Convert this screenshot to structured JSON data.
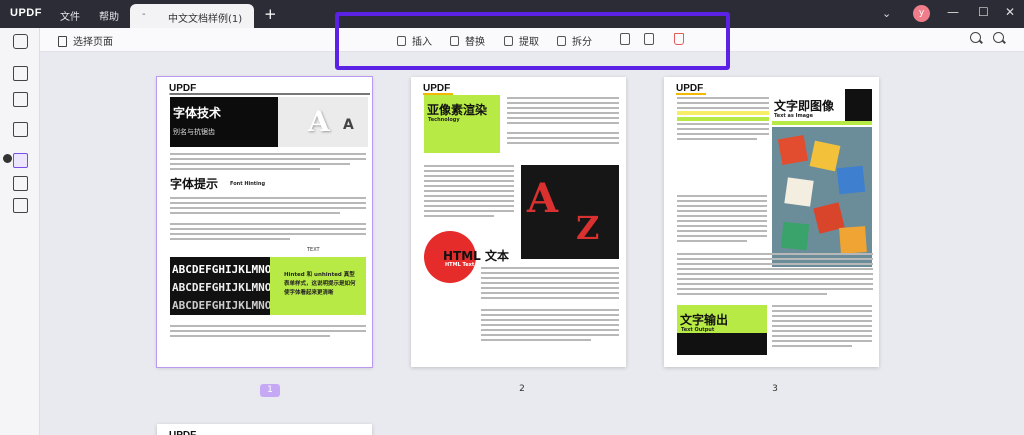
{
  "app": {
    "logo": "UPDF",
    "menu": [
      "文件",
      "帮助"
    ],
    "tab_title": "中文文档样例(1)",
    "tab_close": "-",
    "tab_add": "+",
    "avatar_initial": "y"
  },
  "toolbar": {
    "select_page": "选择页面",
    "insert": "插入",
    "replace": "替换",
    "extract": "提取",
    "split": "拆分",
    "zoom_out_icon": "zoom-out-icon",
    "zoom_in_icon": "zoom-in-icon"
  },
  "pages": [
    {
      "number": "1",
      "brand": "UPDF",
      "heading": "字体技术",
      "subheading": "别名与抗锯齿",
      "heading2": "字体提示",
      "heading2_sub": "Font Hinting",
      "caption": "TEXT",
      "green_text": "Hinted 和 unhinted 真型表单样式，这说明提示是如何使字体看起来更清晰",
      "bw_text": "ABCDEFGHIJKLMNO"
    },
    {
      "number": "2",
      "brand": "UPDF",
      "heading": "亚像素渲染",
      "subheading": "Technology",
      "html_title": "HTML 文本",
      "html_sub": "HTML Text"
    },
    {
      "number": "3",
      "brand": "UPDF",
      "heading": "文字即图像",
      "subheading": "Text as Image",
      "output_title": "文字输出",
      "output_sub": "Text Output"
    }
  ],
  "colors": {
    "accent": "#7b4de8",
    "highlight_border": "#5b22e6",
    "lime": "#b8ea45",
    "red": "#e62b2b",
    "delete": "#e45b5b"
  }
}
